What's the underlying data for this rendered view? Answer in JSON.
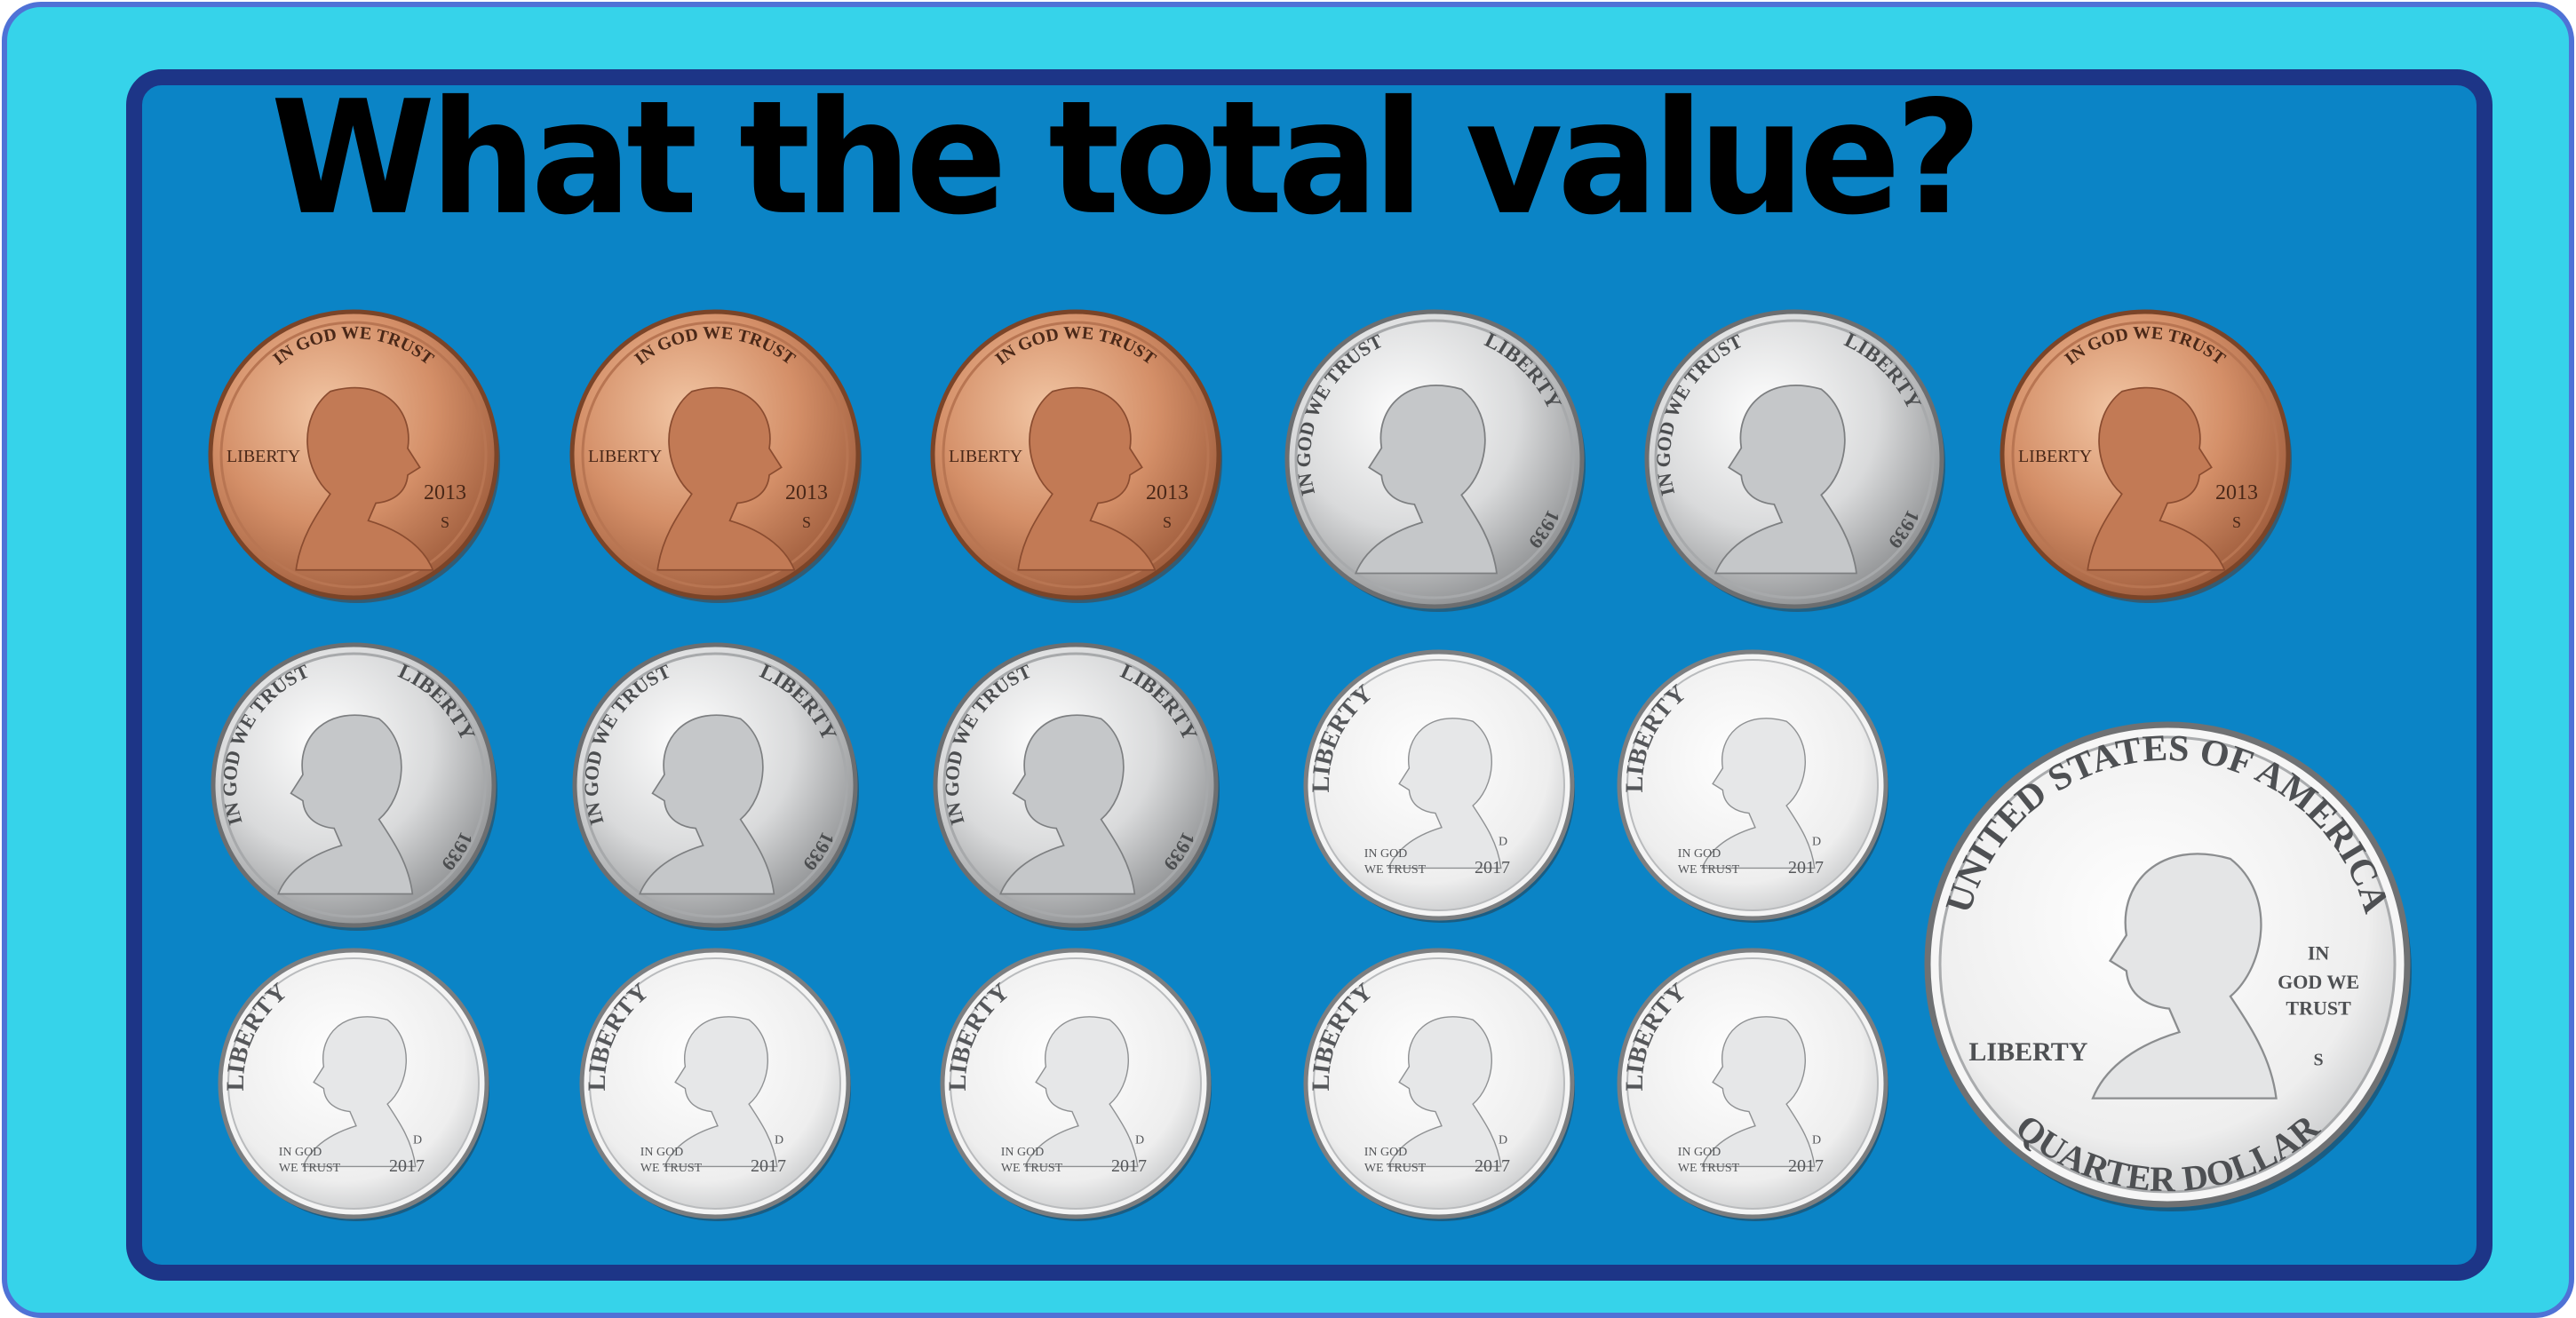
{
  "title": "What the total value?",
  "colors": {
    "outer_frame": "#36d3ea",
    "outer_border": "#4f72d6",
    "board": "#0b84c6",
    "board_border": "#1d3587",
    "penny": "#d48f68",
    "penny_dark": "#9c5a3a",
    "silver": "#d9dadb",
    "silver_dark": "#8a8c8e"
  },
  "coin_text": {
    "penny": {
      "motto": "IN GOD WE TRUST",
      "liberty": "LIBERTY",
      "year": "2013",
      "mint": "S"
    },
    "nickel": {
      "motto": "IN GOD WE TRUST",
      "liberty": "LIBERTY",
      "year": "1939"
    },
    "dime": {
      "liberty": "LIBERTY",
      "motto_1": "IN GOD",
      "motto_2": "WE TRUST",
      "year": "2017",
      "mint": "D"
    },
    "quarter": {
      "top": "UNITED STATES OF AMERICA",
      "bottom": "QUARTER DOLLAR",
      "liberty": "LIBERTY",
      "motto_1": "IN",
      "motto_2": "GOD WE",
      "motto_3": "TRUST",
      "mint": "S"
    }
  },
  "coins": [
    {
      "type": "penny"
    },
    {
      "type": "penny"
    },
    {
      "type": "penny"
    },
    {
      "type": "nickel"
    },
    {
      "type": "nickel"
    },
    {
      "type": "penny"
    },
    {
      "type": "nickel"
    },
    {
      "type": "nickel"
    },
    {
      "type": "nickel"
    },
    {
      "type": "dime"
    },
    {
      "type": "dime"
    },
    {
      "type": "dime"
    },
    {
      "type": "dime"
    },
    {
      "type": "dime"
    },
    {
      "type": "dime"
    },
    {
      "type": "dime"
    },
    {
      "type": "quarter"
    }
  ]
}
